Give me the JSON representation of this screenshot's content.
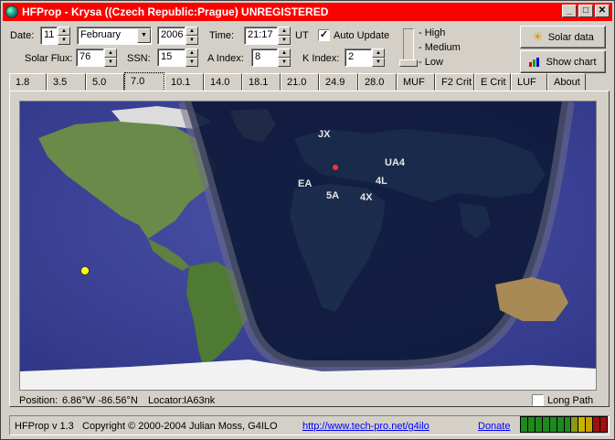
{
  "window": {
    "title": "HFProp - Krysa ((Czech Republic:Prague)  UNREGISTERED"
  },
  "controls": {
    "date_label": "Date:",
    "day": "11",
    "month": "February",
    "year": "2006",
    "time_label": "Time:",
    "time": "21:17",
    "ut_label": "UT",
    "auto_update_label": "Auto Update",
    "solar_flux_label": "Solar Flux:",
    "solar_flux": "76",
    "ssn_label": "SSN:",
    "ssn": "15",
    "a_index_label": "A Index:",
    "a_index": "8",
    "k_index_label": "K Index:",
    "k_index": "2",
    "level_high": "- High",
    "level_medium": "- Medium",
    "level_low": "- Low",
    "solar_data_label": "Solar data",
    "show_chart_label": "Show chart"
  },
  "tabs": [
    "1.8",
    "3.5",
    "5.0",
    "7.0",
    "10.1",
    "14.0",
    "18.1",
    "21.0",
    "24.9",
    "28.0",
    "MUF",
    "F2 Crit",
    "E Crit",
    "LUF",
    "About"
  ],
  "active_tab": "7.0",
  "map": {
    "labels": [
      "JX",
      "UA4",
      "EA",
      "4L",
      "5A",
      "4X"
    ]
  },
  "footer": {
    "position_label": "Position:",
    "position_value": "6.86°W -86.56°N",
    "locator_label": "Locator:",
    "locator_value": "IA63nk",
    "long_path_label": "Long Path"
  },
  "statusbar": {
    "version": "HFProp v 1.3",
    "copyright": "Copyright © 2000-2004  Julian Moss, G4ILO",
    "url": "http://www.tech-pro.net/g4ilo",
    "donate": "Donate"
  },
  "colors": {
    "titlebar": "#ff0000",
    "link": "#0000ff",
    "meter_green": "#1e8a1e",
    "meter_yellow": "#c8b400",
    "meter_red": "#a01010"
  }
}
